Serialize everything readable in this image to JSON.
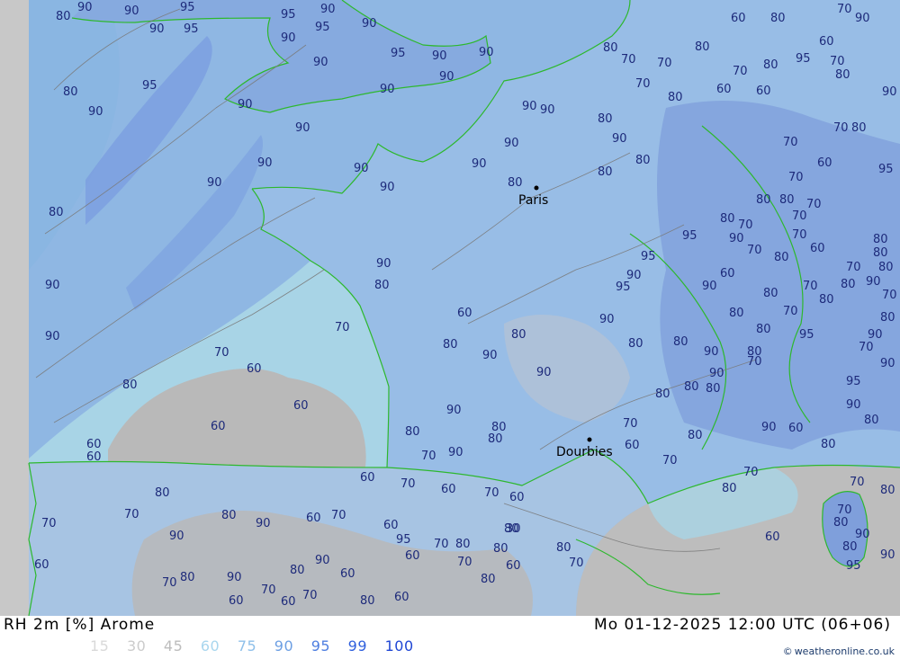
{
  "map": {
    "cities": [
      {
        "name": "Paris"
      },
      {
        "name": "Dourbies"
      }
    ],
    "contour_labels": [
      "90",
      "90",
      "95",
      "80",
      "90",
      "95",
      "95",
      "90",
      "95",
      "90",
      "95",
      "90",
      "90",
      "95",
      "90",
      "90",
      "90",
      "80",
      "90",
      "90",
      "90",
      "90",
      "80",
      "90",
      "90",
      "90",
      "90",
      "90",
      "90",
      "80",
      "90",
      "90",
      "80",
      "70",
      "80",
      "70",
      "80",
      "70",
      "80",
      "90",
      "60",
      "70",
      "60",
      "60",
      "80",
      "70",
      "90",
      "90",
      "80",
      "60",
      "60",
      "60",
      "70",
      "60",
      "60",
      "70",
      "60",
      "70",
      "60",
      "90",
      "80",
      "95",
      "70",
      "80",
      "90",
      "70",
      "80",
      "70",
      "80",
      "80",
      "80",
      "70",
      "60",
      "60",
      "70",
      "60",
      "30",
      "80",
      "90",
      "80",
      "70",
      "60",
      "60",
      "70",
      "60",
      "70",
      "90",
      "60",
      "80",
      "80",
      "90",
      "80",
      "80",
      "70",
      "80",
      "90",
      "80",
      "90",
      "90",
      "80",
      "60",
      "80",
      "90",
      "95",
      "95",
      "90",
      "80",
      "90",
      "95",
      "80",
      "80",
      "80",
      "90",
      "90",
      "80",
      "70",
      "60",
      "70",
      "90",
      "80",
      "70",
      "60",
      "80",
      "80",
      "80",
      "60",
      "70",
      "70",
      "80",
      "90",
      "80",
      "90",
      "95",
      "90",
      "95",
      "80",
      "90",
      "70",
      "80",
      "70",
      "90",
      "70",
      "95",
      "80",
      "80",
      "70",
      "80",
      "90",
      "80",
      "60",
      "80",
      "70",
      "90",
      "80",
      "70",
      "60",
      "70",
      "70",
      "80",
      "80",
      "90",
      "80",
      "80",
      "80",
      "70",
      "70",
      "80",
      "80",
      "70",
      "70",
      "70",
      "60",
      "70",
      "80",
      "95",
      "90",
      "80",
      "95",
      "60",
      "70",
      "80",
      "70",
      "90",
      "80",
      "60",
      "80",
      "70",
      "60",
      "60",
      "70",
      "70",
      "80"
    ],
    "colors": {
      "sea_base": "#8fb7e3",
      "rh_90": "#7fa3dc",
      "rh_95": "#6d8fd6",
      "rh_80": "#a0c3e6",
      "rh_70": "#a8d4e6",
      "rh_60": "#b9b9b9",
      "offmap": "#c8c8c8",
      "coast": "#2db82d",
      "contour": "#7a7a7a"
    }
  },
  "footer": {
    "title_left": "RH 2m [%] Arome",
    "title_right": "Mo 01-12-2025 12:00 UTC (06+06)",
    "credit": "weatheronline.co.uk",
    "credit_symbol": "©",
    "scale": [
      {
        "value": "15",
        "color": "#d9d9d9"
      },
      {
        "value": "30",
        "color": "#cccccc"
      },
      {
        "value": "45",
        "color": "#bdbdbd"
      },
      {
        "value": "60",
        "color": "#a9d6ee"
      },
      {
        "value": "75",
        "color": "#8fc0ea"
      },
      {
        "value": "90",
        "color": "#6d9fe3"
      },
      {
        "value": "95",
        "color": "#4f7fe0"
      },
      {
        "value": "99",
        "color": "#3060dd"
      },
      {
        "value": "100",
        "color": "#1f46d4"
      }
    ]
  }
}
